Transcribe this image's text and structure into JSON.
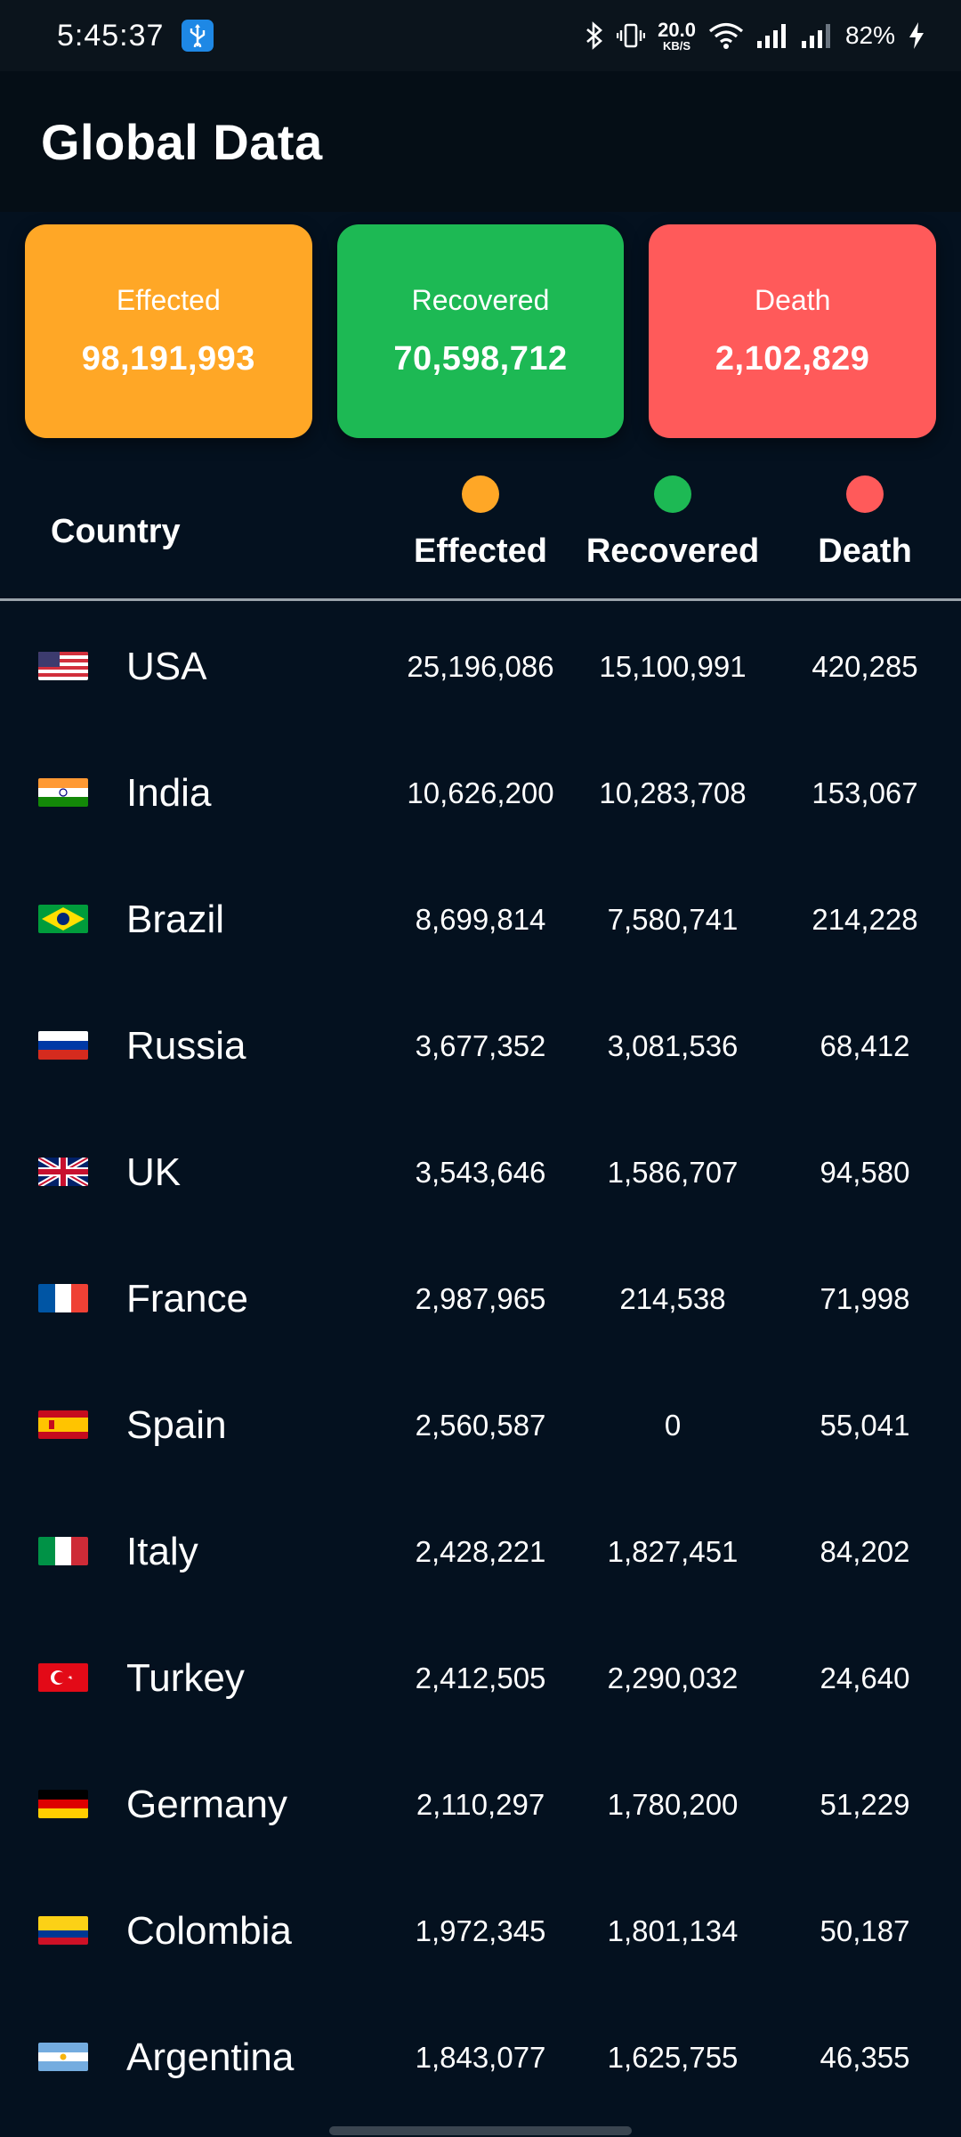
{
  "status_bar": {
    "time": "5:45:37",
    "net_speed_value": "20.0",
    "net_speed_unit": "KB/S",
    "battery": "82%"
  },
  "app_bar": {
    "title": "Global Data"
  },
  "summary": [
    {
      "label": "Effected",
      "value": "98,191,993",
      "color": "#ffa726"
    },
    {
      "label": "Recovered",
      "value": "70,598,712",
      "color": "#1db954"
    },
    {
      "label": "Death",
      "value": "2,102,829",
      "color": "#ff5a5a"
    }
  ],
  "table": {
    "headers": {
      "country": "Country",
      "effected": "Effected",
      "recovered": "Recovered",
      "death": "Death"
    },
    "dot_colors": {
      "effected": "#ffa726",
      "recovered": "#1db954",
      "death": "#ff5a5a"
    },
    "rows": [
      {
        "country": "USA",
        "effected": "25,196,086",
        "recovered": "15,100,991",
        "death": "420,285"
      },
      {
        "country": "India",
        "effected": "10,626,200",
        "recovered": "10,283,708",
        "death": "153,067"
      },
      {
        "country": "Brazil",
        "effected": "8,699,814",
        "recovered": "7,580,741",
        "death": "214,228"
      },
      {
        "country": "Russia",
        "effected": "3,677,352",
        "recovered": "3,081,536",
        "death": "68,412"
      },
      {
        "country": "UK",
        "effected": "3,543,646",
        "recovered": "1,586,707",
        "death": "94,580"
      },
      {
        "country": "France",
        "effected": "2,987,965",
        "recovered": "214,538",
        "death": "71,998"
      },
      {
        "country": "Spain",
        "effected": "2,560,587",
        "recovered": "0",
        "death": "55,041"
      },
      {
        "country": "Italy",
        "effected": "2,428,221",
        "recovered": "1,827,451",
        "death": "84,202"
      },
      {
        "country": "Turkey",
        "effected": "2,412,505",
        "recovered": "2,290,032",
        "death": "24,640"
      },
      {
        "country": "Germany",
        "effected": "2,110,297",
        "recovered": "1,780,200",
        "death": "51,229"
      },
      {
        "country": "Colombia",
        "effected": "1,972,345",
        "recovered": "1,801,134",
        "death": "50,187"
      },
      {
        "country": "Argentina",
        "effected": "1,843,077",
        "recovered": "1,625,755",
        "death": "46,355"
      }
    ]
  }
}
